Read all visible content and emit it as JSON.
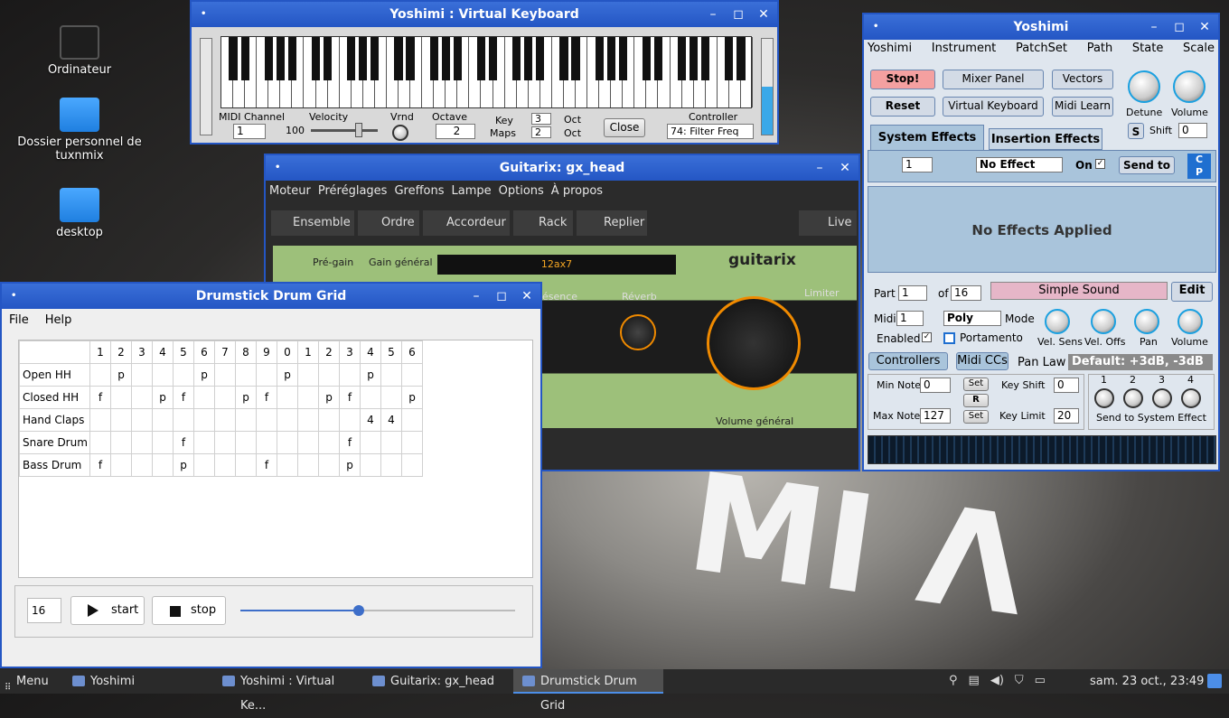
{
  "desktop": {
    "icons": [
      {
        "label": "Ordinateur"
      },
      {
        "label": "Dossier personnel de tuxnmix"
      },
      {
        "label": "desktop"
      }
    ]
  },
  "vkeyboard": {
    "title": "Yoshimi : Virtual Keyboard",
    "midi_channel_label": "MIDI Channel",
    "midi_channel": "1",
    "velocity_label": "Velocity",
    "velocity_value": "100",
    "vrnd_label": "Vrnd",
    "octave_label": "Octave",
    "octave": "2",
    "key_label": "Key",
    "maps_label": "Maps",
    "key_oct": "3",
    "maps_oct": "2",
    "oct1": "Oct",
    "oct2": "Oct",
    "close": "Close",
    "controller_label": "Controller",
    "controller": "74: Filter Freq"
  },
  "guitarix": {
    "title": "Guitarix: gx_head",
    "menu": [
      "Moteur",
      "Préréglages",
      "Greffons",
      "Lampe",
      "Options",
      "À propos"
    ],
    "toolbar": [
      "Ensemble",
      "Ordre",
      "Accordeur",
      "Rack",
      "Replier"
    ],
    "live": "Live",
    "pregain": "Pré-gain",
    "gain": "Gain général",
    "preset": "12ax7",
    "brand": "guitarix",
    "presence": "ésence",
    "reverb": "Réverb",
    "limiter": "Limiter",
    "volume": "Volume général"
  },
  "yoshimi": {
    "title": "Yoshimi",
    "menu": [
      "Yoshimi",
      "Instrument",
      "PatchSet",
      "Path",
      "State",
      "Scale"
    ],
    "stop": "Stop!",
    "reset": "Reset",
    "mixer": "Mixer Panel",
    "vkbd": "Virtual Keyboard",
    "vectors": "Vectors",
    "midilearn": "Midi Learn",
    "detune": "Detune",
    "volume": "Volume",
    "s": "S",
    "shift": "Shift",
    "shift_val": "0",
    "tab_sys": "System Effects",
    "tab_ins": "Insertion Effects",
    "fx_num": "1",
    "fx": "No Effect",
    "on": "On",
    "sendto": "Send to",
    "c": "C",
    "p": "P",
    "noeffects": "No Effects Applied",
    "part": "Part",
    "part_val": "1",
    "of": "of",
    "of_val": "16",
    "instrument": "Simple Sound",
    "edit": "Edit",
    "midi": "Midi",
    "midi_val": "1",
    "poly": "Poly",
    "mode": "Mode",
    "velsens": "Vel. Sens",
    "veloffs": "Vel. Offs",
    "pan": "Pan",
    "vol": "Volume",
    "enabled": "Enabled",
    "portamento": "Portamento",
    "controllers": "Controllers",
    "midiccs": "Midi CCs",
    "panlaw": "Pan Law",
    "panlaw_val": "Default: +3dB, -3dB",
    "minnote": "Min Note",
    "minnote_val": "0",
    "maxnote": "Max Note",
    "maxnote_val": "127",
    "set": "Set",
    "r": "R",
    "keyshift": "Key Shift",
    "keyshift_val": "0",
    "keylimit": "Key Limit",
    "keylimit_val": "20",
    "send_nums": [
      "1",
      "2",
      "3",
      "4"
    ],
    "sendsys": "Send to System Effect"
  },
  "drum": {
    "title": "Drumstick Drum Grid",
    "menu": [
      "File",
      "Help"
    ],
    "header": [
      "1",
      "2",
      "3",
      "4",
      "5",
      "6",
      "7",
      "8",
      "9",
      "0",
      "1",
      "2",
      "3",
      "4",
      "5",
      "6"
    ],
    "rows": [
      {
        "name": "Open HH",
        "cells": [
          "",
          "p",
          "",
          "",
          "",
          "p",
          "",
          "",
          "",
          "p",
          "",
          "",
          "",
          "p",
          "",
          ""
        ]
      },
      {
        "name": "Closed HH",
        "cells": [
          "f",
          "",
          "",
          "p",
          "f",
          "",
          "",
          "p",
          "f",
          "",
          "",
          "p",
          "f",
          "",
          "",
          "p"
        ]
      },
      {
        "name": "Hand Claps",
        "cells": [
          "",
          "",
          "",
          "",
          "",
          "",
          "",
          "",
          "",
          "",
          "",
          "",
          "",
          "4",
          "4",
          ""
        ]
      },
      {
        "name": "Snare Drum",
        "cells": [
          "",
          "",
          "",
          "",
          "f",
          "",
          "",
          "",
          "",
          "",
          "",
          "",
          "f",
          "",
          "",
          ""
        ]
      },
      {
        "name": "Bass Drum",
        "cells": [
          "f",
          "",
          "",
          "",
          "p",
          "",
          "",
          "",
          "f",
          "",
          "",
          "",
          "p",
          "",
          "",
          ""
        ]
      }
    ],
    "spin": "16",
    "start": "start",
    "stop": "stop",
    "tempo_pct": 0.43
  },
  "taskbar": {
    "menu": "Menu",
    "items": [
      "Yoshimi",
      "Yoshimi : Virtual Ke...",
      "Guitarix: gx_head",
      "Drumstick Drum Grid"
    ],
    "clock": "sam. 23 oct., 23:49"
  }
}
